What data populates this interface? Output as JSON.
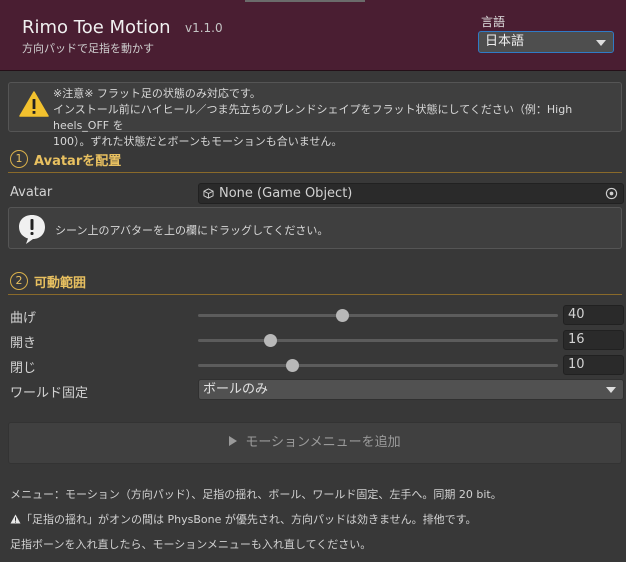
{
  "header": {
    "title": "Rimo Toe Motion",
    "version": "v1.1.0",
    "subtitle": "方向パッドで足指を動かす",
    "language_label": "言語",
    "language_value": "日本語"
  },
  "warning": {
    "lines": [
      "※注意※ フラット足の状態のみ対応です。",
      "インストール前にハイヒール／つま先立ちのブレンドシェイプをフラット状態にしてください（例：High heels_OFF を",
      "100）。ずれた状態だとボーンもモーションも合いません。"
    ]
  },
  "section1": {
    "number": "1",
    "title": "Avatarを配置",
    "avatar_label": "Avatar",
    "avatar_value": "None (Game Object)",
    "info_text": "シーン上のアバターを上の欄にドラッグしてください。"
  },
  "section2": {
    "number": "2",
    "title": "可動範囲",
    "sliders": [
      {
        "label": "曲げ",
        "value": "40",
        "fraction": 0.4
      },
      {
        "label": "開き",
        "value": "16",
        "fraction": 0.2
      },
      {
        "label": "閉じ",
        "value": "10",
        "fraction": 0.26
      }
    ],
    "world_fix_label": "ワールド固定",
    "world_fix_value": "ボールのみ"
  },
  "add_button_label": "モーションメニューを追加",
  "notes": {
    "menu": "メニュー：モーション（方向パッド）、足指の揺れ、ボール、ワールド固定、左手へ。同期 20 bit。",
    "physbone": "「足指の揺れ」がオンの間は PhysBone が優先され、方向パッドは効きません。排他です。",
    "reinsert": "足指ボーンを入れ直したら、モーションメニューも入れ直してください。"
  },
  "colors": {
    "header_bg": "#4a1e32",
    "accent_gold": "#e8c060",
    "focus_blue": "#2f7bc6",
    "warning_yellow": "#f2c12e"
  }
}
